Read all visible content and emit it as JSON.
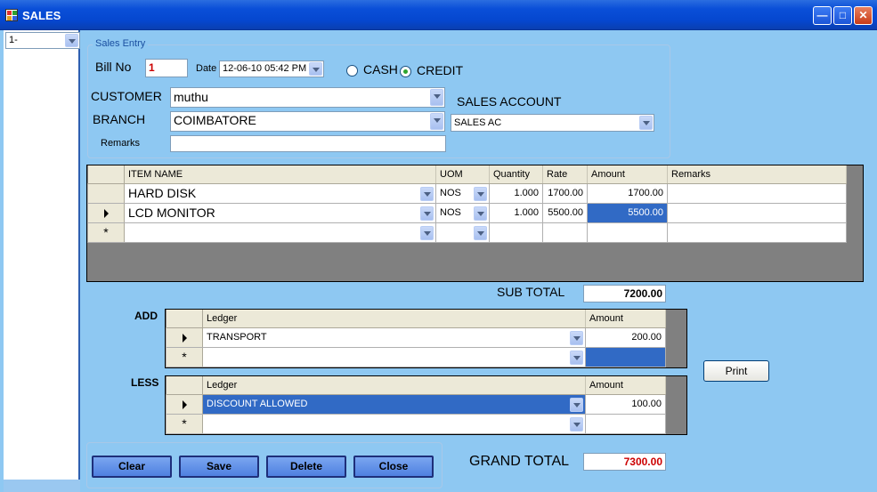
{
  "window": {
    "title": "SALES"
  },
  "left_panel": {
    "selected": "1-"
  },
  "sales_entry": {
    "group_title": "Sales Entry",
    "bill_no_label": "Bill No",
    "bill_no": "1",
    "date_label": "Date",
    "date_value": "12-06-10 05:42 PM",
    "cash_label": "CASH",
    "credit_label": "CREDIT",
    "payment_mode": "CREDIT",
    "customer_label": "CUSTOMER",
    "customer": "muthu",
    "branch_label": "BRANCH",
    "branch": "COIMBATORE",
    "remarks_label": "Remarks",
    "remarks": "",
    "sales_account_label": "SALES ACCOUNT",
    "sales_account": "SALES AC"
  },
  "items": {
    "columns": [
      "ITEM NAME",
      "UOM",
      "Quantity",
      "Rate",
      "Amount",
      "Remarks"
    ],
    "rows": [
      {
        "item": "HARD DISK",
        "uom": "NOS",
        "qty": "1.000",
        "rate": "1700.00",
        "amount": "1700.00",
        "remarks": ""
      },
      {
        "item": "LCD MONITOR",
        "uom": "NOS",
        "qty": "1.000",
        "rate": "5500.00",
        "amount": "5500.00",
        "remarks": ""
      }
    ],
    "new_row_marker": "*"
  },
  "sub_total": {
    "label": "SUB TOTAL",
    "value": "7200.00"
  },
  "add": {
    "label": "ADD",
    "columns": [
      "Ledger",
      "Amount"
    ],
    "rows": [
      {
        "ledger": "TRANSPORT",
        "amount": "200.00"
      }
    ]
  },
  "less": {
    "label": "LESS",
    "columns": [
      "Ledger",
      "Amount"
    ],
    "rows": [
      {
        "ledger": "DISCOUNT ALLOWED",
        "amount": "100.00"
      }
    ]
  },
  "print_label": "Print",
  "grand_total": {
    "label": "GRAND TOTAL",
    "value": "7300.00"
  },
  "buttons": {
    "clear": "Clear",
    "save": "Save",
    "delete": "Delete",
    "close": "Close"
  },
  "colors": {
    "background": "#8ec8f2",
    "selection": "#316ac5",
    "grand_total_text": "#cc0000",
    "bill_no_text": "#cc0000"
  }
}
